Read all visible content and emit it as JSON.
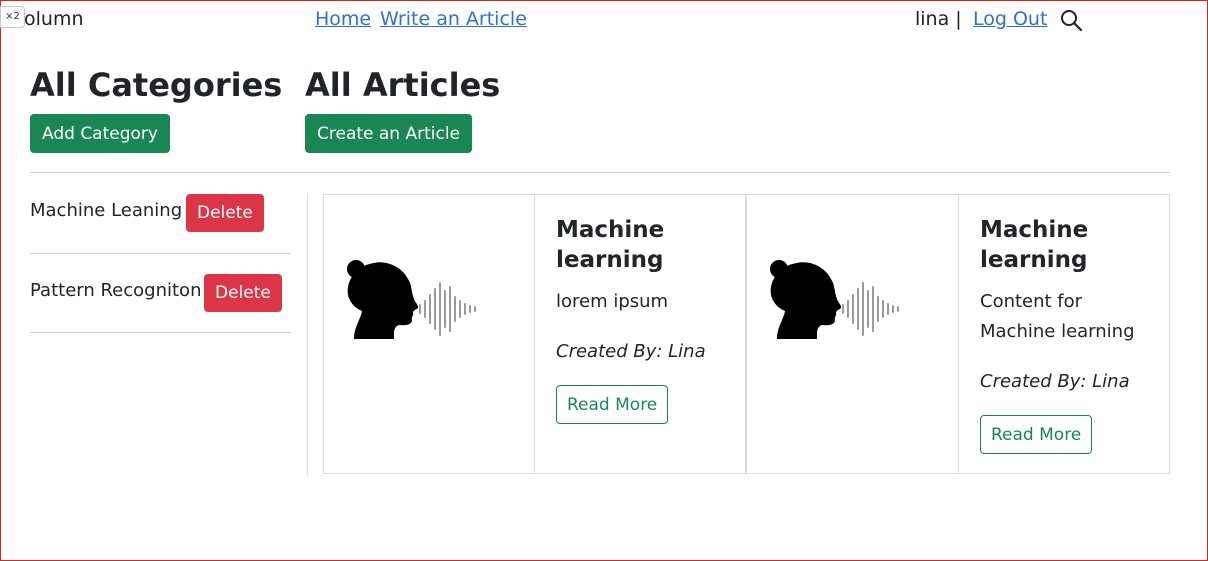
{
  "nav": {
    "zoom_badge": "×2",
    "brand": "olumn",
    "links": [
      "Home",
      "Write an Article"
    ],
    "user": "lina |",
    "logout": "Log Out"
  },
  "categories": {
    "heading": "All Categories",
    "add_button": "Add Category",
    "items": [
      {
        "name": "Machine Leaning",
        "delete_label": "Delete"
      },
      {
        "name": "Pattern Recogniton",
        "delete_label": "Delete"
      }
    ]
  },
  "articles": {
    "heading": "All Articles",
    "create_button": "Create an Article",
    "items": [
      {
        "title": "Machine learning",
        "content": "lorem ipsum",
        "author": "Created By: Lina",
        "read_more": "Read More",
        "image_icon": "head-voice-icon"
      },
      {
        "title": "Machine learning",
        "content": "Content for Machine learning",
        "author": "Created By: Lina",
        "read_more": "Read More",
        "image_icon": "head-voice-icon"
      }
    ]
  },
  "colors": {
    "success": "#198754",
    "danger": "#dc3545",
    "link": "#2f6fd8"
  }
}
